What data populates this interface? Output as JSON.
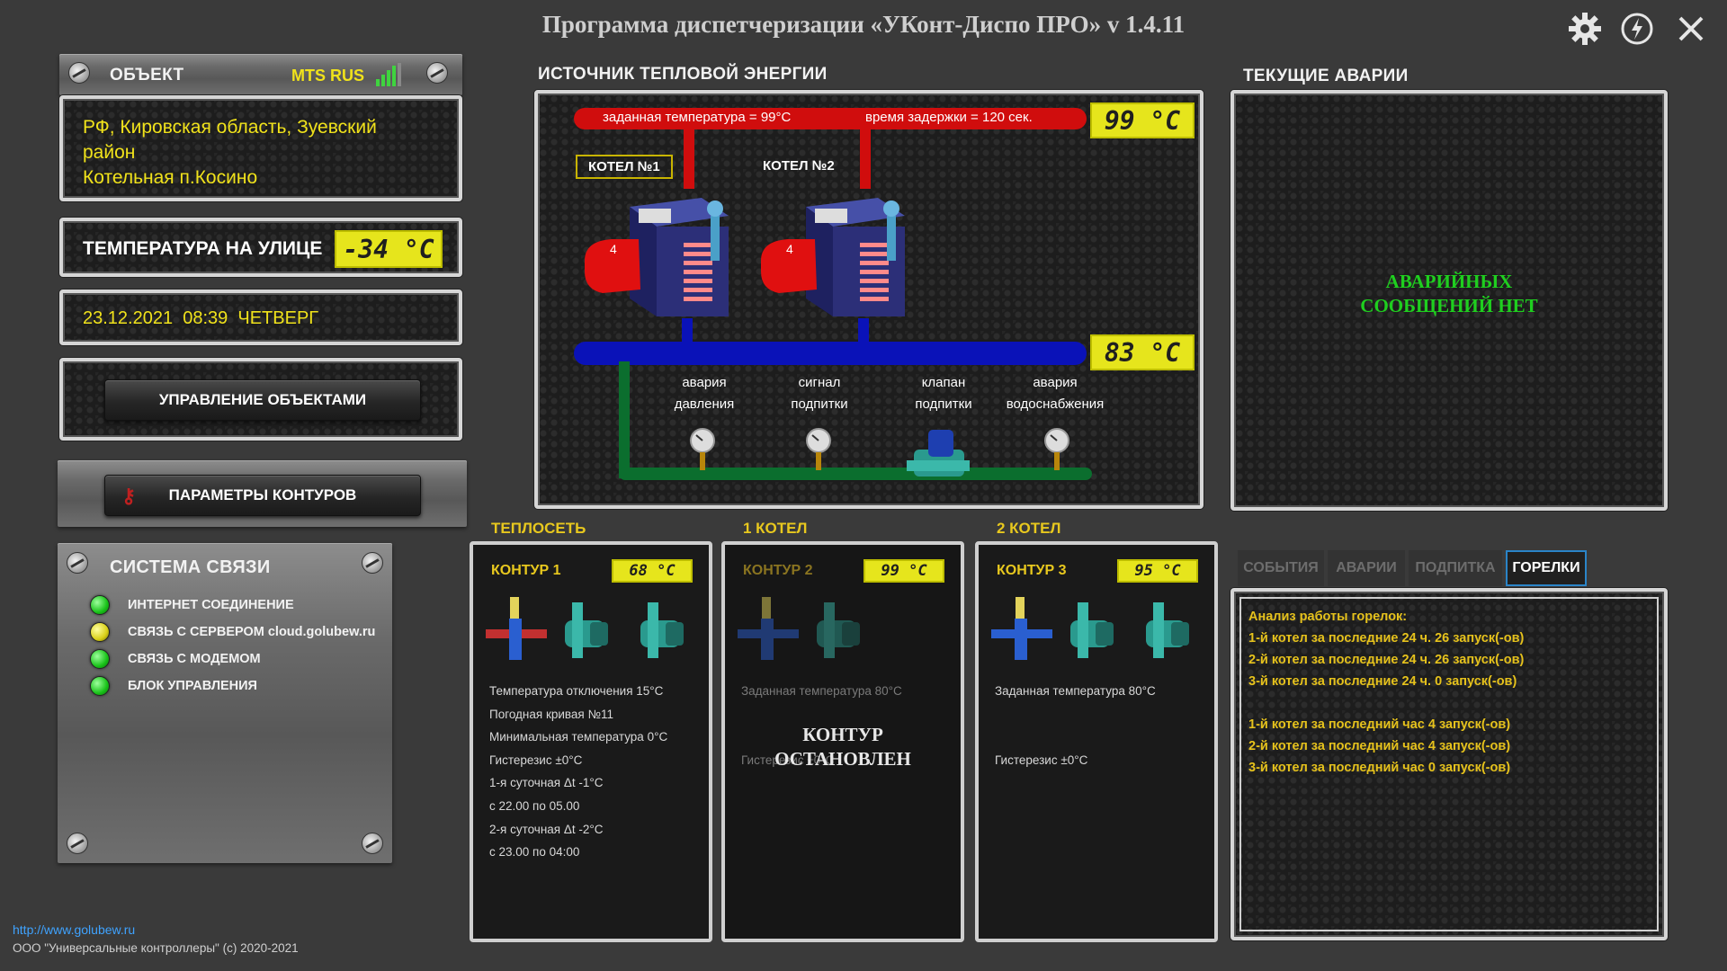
{
  "app": {
    "title": "Программа диспетчеризации «УКонт-Диспо ПРО» v 1.4.11",
    "icons": [
      "settings-icon",
      "power-icon",
      "close-icon"
    ]
  },
  "object_panel": {
    "header": "ОБЪЕКТ",
    "operator": "MTS RUS",
    "address_line1": "РФ, Кировская область, Зуевский",
    "address_line2": "район",
    "address_line3": "Котельная п.Косино",
    "outdoor_label": "ТЕМПЕРАТУРА НА УЛИЦЕ",
    "outdoor_temp": "-34 °C",
    "datetime": "23.12.2021  08:39  ЧЕТВЕРГ",
    "manage_button": "УПРАВЛЕНИЕ ОБЪЕКТАМИ",
    "params_button": "ПАРАМЕТРЫ КОНТУРОВ"
  },
  "comm": {
    "title": "СИСТЕМА СВЯЗИ",
    "items": [
      {
        "label": "ИНТЕРНЕТ СОЕДИНЕНИЕ",
        "status": "green"
      },
      {
        "label": "СВЯЗЬ С СЕРВЕРОМ cloud.golubew.ru",
        "status": "yellow"
      },
      {
        "label": "СВЯЗЬ С МОДЕМОМ",
        "status": "green"
      },
      {
        "label": "БЛОК УПРАВЛЕНИЯ",
        "status": "green"
      }
    ]
  },
  "source": {
    "title": "ИСТОЧНИК ТЕПЛОВОЙ ЭНЕРГИИ",
    "set_temp": "заданная температура = 99°C",
    "delay": "время задержки = 120 сек.",
    "supply_temp": "99 °C",
    "return_temp": "83 °C",
    "boiler1": "КОТЕЛ №1",
    "boiler2": "КОТЕЛ №2",
    "sensors": [
      {
        "l1": "авария",
        "l2": "давления"
      },
      {
        "l1": "сигнал",
        "l2": "подпитки"
      },
      {
        "l1": "клапан",
        "l2": "подпитки"
      },
      {
        "l1": "авария",
        "l2": "водоснабжения"
      }
    ]
  },
  "alarms": {
    "title": "ТЕКУЩИЕ АВАРИИ",
    "line1": "АВАРИЙНЫХ",
    "line2": "СООБЩЕНИЙ НЕТ"
  },
  "contours": [
    {
      "group": "ТЕПЛОСЕТЬ",
      "name": "КОНТУР 1",
      "temp": "68 °C",
      "lines": [
        "Температура отключения 15°C",
        "Погодная кривая №11",
        "Минимальная температура 0°C",
        "Гистерезис ±0°C",
        "1-я суточная Δt -1°C",
        "с 22.00 по 05.00",
        "2-я суточная Δt -2°C",
        "с 23.00 по 04:00"
      ]
    },
    {
      "group": "1 КОТЕЛ",
      "name": "КОНТУР 2",
      "temp": "99 °C",
      "lines": [
        "Заданная температура 80°C",
        "",
        "",
        "Гистерезис ±0°C"
      ],
      "stopped1": "КОНТУР",
      "stopped2": "ОСТАНОВЛЕН"
    },
    {
      "group": "2 КОТЕЛ",
      "name": "КОНТУР 3",
      "temp": "95 °C",
      "lines": [
        "Заданная температура 80°C",
        "",
        "",
        "Гистерезис ±0°C"
      ]
    }
  ],
  "log": {
    "tabs": [
      "СОБЫТИЯ",
      "АВАРИИ",
      "ПОДПИТКА",
      "ГОРЕЛКИ"
    ],
    "active_tab": "ГОРЕЛКИ",
    "lines": [
      "Анализ работы горелок:",
      "1-й котел за последние 24 ч. 26 запуск(-ов)",
      "2-й котел за последние 24 ч. 26 запуск(-ов)",
      "3-й котел за последние 24 ч. 0 запуск(-ов)",
      "",
      "1-й котел за последний час 4 запуск(-ов)",
      "2-й котел за последний час 4 запуск(-ов)",
      "3-й котел за последний час 0 запуск(-ов)"
    ]
  },
  "footer": {
    "url": "http://www.golubew.ru",
    "copyright": "ООО \"Универсальные контроллеры\" (с) 2020-2021"
  },
  "colors": {
    "lcd": "#e6e51c",
    "hot_pipe": "#d00d0d",
    "cold_pipe": "#0a12b8",
    "feed_pipe": "#0b6e2e",
    "alarm_ok_text": "#1fcf1f",
    "log_text": "#e6c21c",
    "active_tab_border": "#2a84c8"
  }
}
